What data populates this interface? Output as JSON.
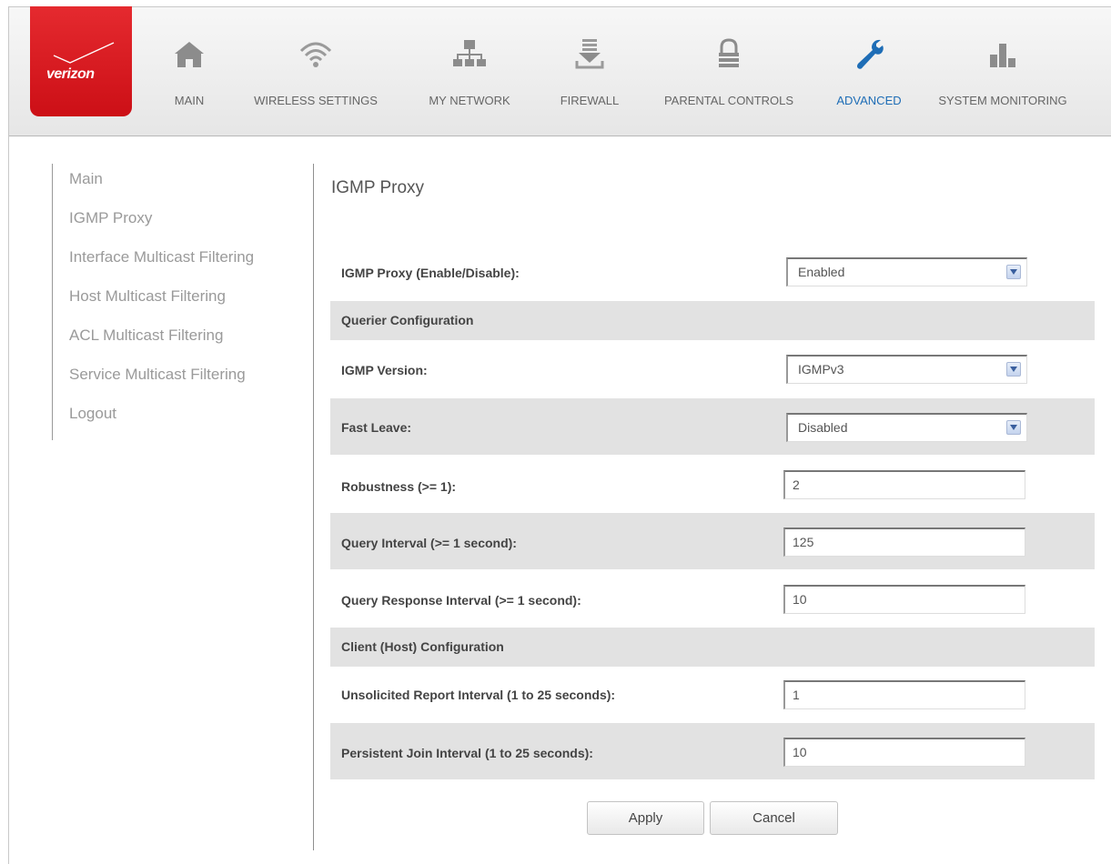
{
  "brand": {
    "logo_text": "verizon"
  },
  "nav": {
    "items": [
      {
        "label": "MAIN",
        "icon": "home-icon"
      },
      {
        "label": "WIRELESS SETTINGS",
        "icon": "wifi-icon"
      },
      {
        "label": "MY NETWORK",
        "icon": "network-icon"
      },
      {
        "label": "FIREWALL",
        "icon": "firewall-icon"
      },
      {
        "label": "PARENTAL CONTROLS",
        "icon": "lock-icon"
      },
      {
        "label": "ADVANCED",
        "icon": "wrench-icon",
        "active": true
      },
      {
        "label": "SYSTEM MONITORING",
        "icon": "bar-chart-icon"
      }
    ],
    "active_color": "#1e6db6"
  },
  "sidebar": {
    "items": [
      {
        "label": "Main"
      },
      {
        "label": "IGMP Proxy"
      },
      {
        "label": "Interface Multicast Filtering"
      },
      {
        "label": "Host Multicast Filtering"
      },
      {
        "label": "ACL Multicast Filtering"
      },
      {
        "label": "Service Multicast Filtering"
      },
      {
        "label": "Logout"
      }
    ]
  },
  "main": {
    "title": "IGMP Proxy",
    "igmp_proxy": {
      "label": "IGMP Proxy (Enable/Disable):",
      "value": "Enabled"
    },
    "querier_section": "Querier Configuration",
    "igmp_version": {
      "label": "IGMP Version:",
      "value": "IGMPv3"
    },
    "fast_leave": {
      "label": "Fast Leave:",
      "value": "Disabled"
    },
    "robustness": {
      "label": "Robustness (>= 1):",
      "value": "2"
    },
    "query_interval": {
      "label": "Query Interval (>= 1 second):",
      "value": "125"
    },
    "query_response_interval": {
      "label": "Query Response Interval (>= 1 second):",
      "value": "10"
    },
    "client_section": "Client (Host) Configuration",
    "unsolicited_report_interval": {
      "label": "Unsolicited Report Interval (1 to 25 seconds):",
      "value": "1"
    },
    "persistent_join_interval": {
      "label": "Persistent Join Interval (1 to 25 seconds):",
      "value": "10"
    },
    "apply_label": "Apply",
    "cancel_label": "Cancel"
  },
  "colors": {
    "brand_red": "#e52a2f",
    "row_shade": "#e2e2e2"
  }
}
